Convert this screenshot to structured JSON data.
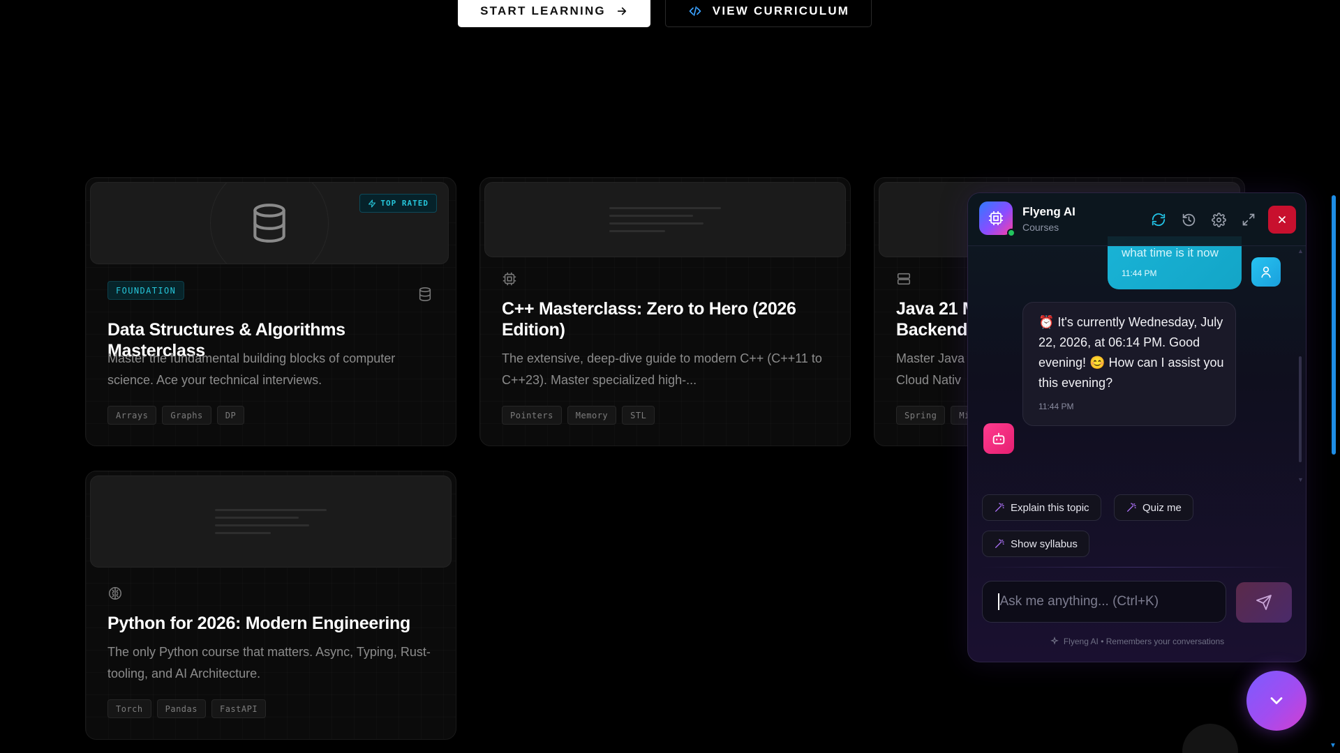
{
  "hero": {
    "start_label": "START LEARNING",
    "curriculum_label": "VIEW CURRICULUM"
  },
  "courses": [
    {
      "title": "Data Structures & Algorithms Masterclass",
      "description": "Master the fundamental building blocks of computer science. Ace your technical interviews.",
      "level": "FOUNDATION",
      "badge": "TOP RATED",
      "icon": "database-icon",
      "tags": [
        "Arrays",
        "Graphs",
        "DP"
      ]
    },
    {
      "title": "C++ Masterclass: Zero to Hero (2026 Edition)",
      "description": "The extensive, deep-dive guide to modern C++ (C++11 to C++23). Master specialized high-...",
      "icon": "cpu-icon",
      "tags": [
        "Pointers",
        "Memory",
        "STL"
      ]
    },
    {
      "title": "Java 21 M... Backend ...",
      "title_line1": "Java 21 M",
      "title_line2": "Backend",
      "description_line1": "Master Java",
      "description_line2": "Cloud Nativ",
      "icon": "server-icon",
      "tags": [
        "Spring",
        "Mi"
      ]
    },
    {
      "title": "Python for 2026: Modern Engineering",
      "description": "The only Python course that matters. Async, Typing, Rust-tooling, and AI Architecture.",
      "icon": "brain-icon",
      "tags": [
        "Torch",
        "Pandas",
        "FastAPI"
      ]
    }
  ],
  "chat": {
    "assistant_name": "Flyeng AI",
    "context": "Courses",
    "user_message": "what time is it now",
    "user_time": "11:44 PM",
    "bot_message": "⏰ It's currently Wednesday, July 22, 2026, at 06:14 PM. Good evening! 😊 How can I assist you this evening?",
    "bot_time": "11:44 PM",
    "suggestions": [
      "Explain this topic",
      "Quiz me",
      "Show syllabus"
    ],
    "input_placeholder": "Ask me anything... (Ctrl+K)",
    "footer_note": "Flyeng AI • Remembers your conversations",
    "colors": {
      "accent_cyan": "#19b3d6",
      "close_red": "#c8102e",
      "bot_pink": "#e61f72"
    }
  }
}
